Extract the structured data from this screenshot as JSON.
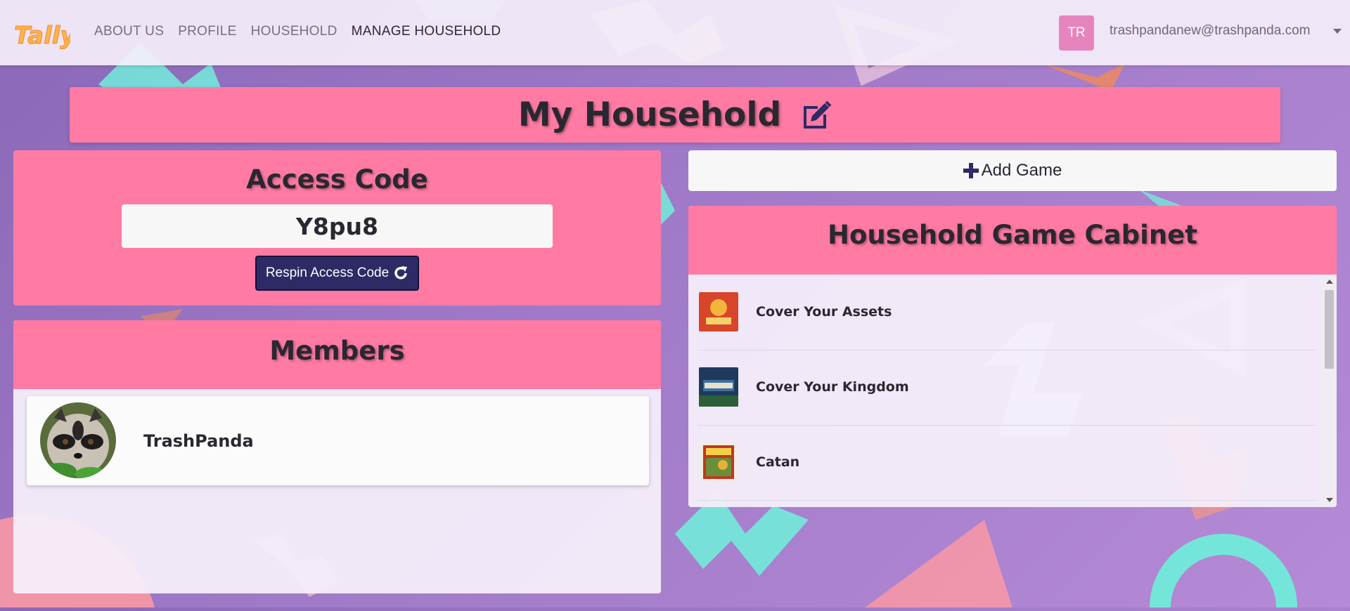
{
  "nav": {
    "logo_text": "Tally",
    "links": [
      {
        "label": "ABOUT US"
      },
      {
        "label": "PROFILE"
      },
      {
        "label": "HOUSEHOLD"
      },
      {
        "label": "MANAGE HOUSEHOLD",
        "active": true
      }
    ],
    "user_initials": "TR",
    "user_email": "trashpandanew@trashpanda.com"
  },
  "page": {
    "title": "My Household",
    "edit_icon": "edit-icon"
  },
  "access": {
    "heading": "Access Code",
    "code": "Y8pu8",
    "respin_label": "Respin Access Code"
  },
  "members": {
    "heading": "Members",
    "list": [
      {
        "name": "TrashPanda"
      }
    ]
  },
  "cabinet": {
    "add_game_label": "Add Game",
    "heading": "Household Game Cabinet",
    "games": [
      {
        "name": "Cover Your Assets"
      },
      {
        "name": "Cover Your Kingdom"
      },
      {
        "name": "Catan"
      }
    ]
  },
  "colors": {
    "accent_pink": "#ff7ba4",
    "button_navy": "#2d2a66",
    "avatar_pink": "#e685bd",
    "background_purple": "#a07ac8"
  }
}
